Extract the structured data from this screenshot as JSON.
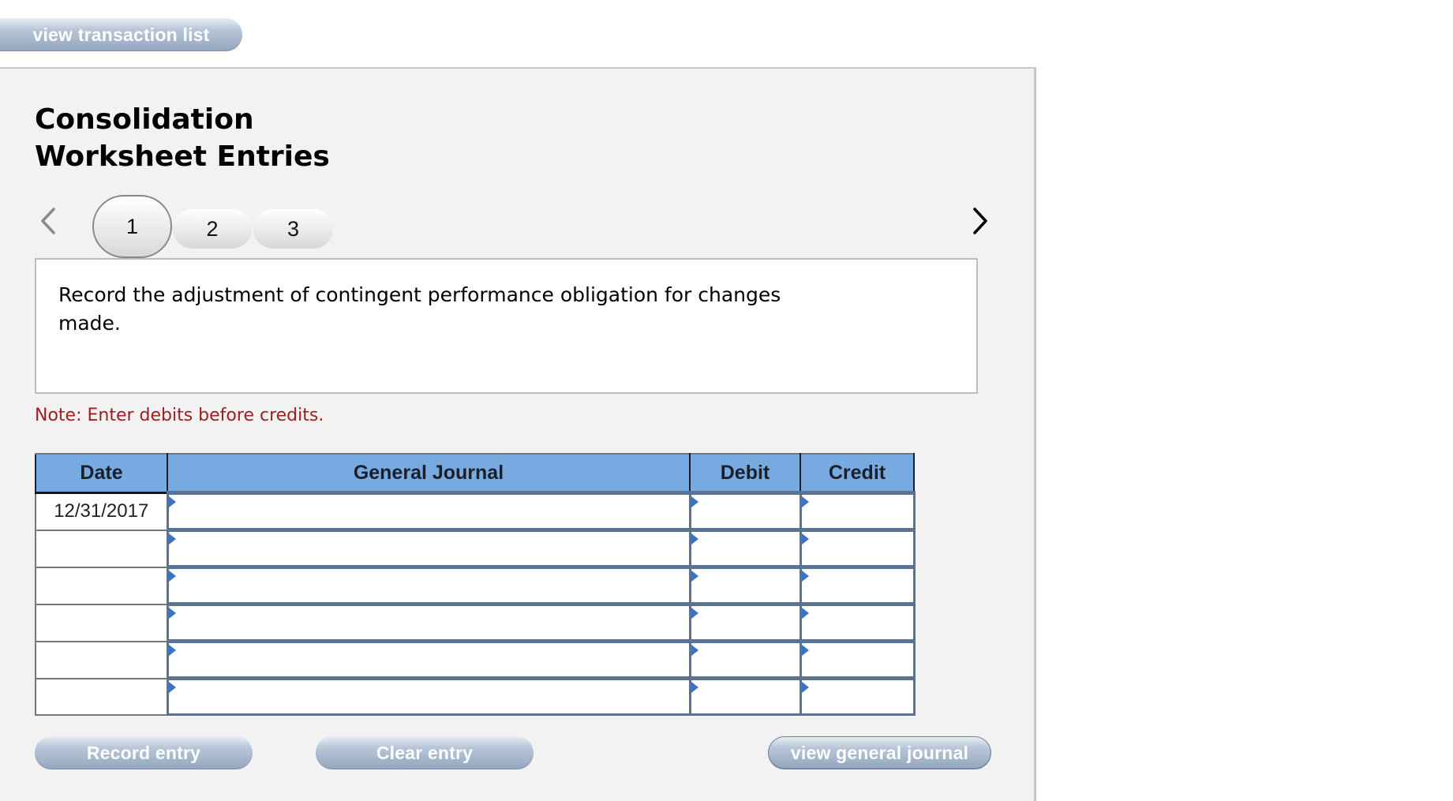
{
  "top_button": {
    "label": "view transaction list"
  },
  "panel": {
    "title_line1": "Consolidation",
    "title_line2": "Worksheet Entries",
    "nav": {
      "prev_icon": "chevron-left-icon",
      "next_icon": "chevron-right-icon"
    },
    "tabs": [
      {
        "label": "1",
        "active": true
      },
      {
        "label": "2",
        "active": false
      },
      {
        "label": "3",
        "active": false
      }
    ],
    "prompt": "Record the adjustment of contingent performance obligation for changes made.",
    "note": "Note: Enter debits before credits.",
    "colors": {
      "header_bg": "#78aae2",
      "note_text": "#a01e1e",
      "input_border": "#5a7394"
    }
  },
  "journal": {
    "columns": [
      "Date",
      "General Journal",
      "Debit",
      "Credit"
    ],
    "rows": [
      {
        "date": "12/31/2017",
        "account": "",
        "debit": "",
        "credit": ""
      },
      {
        "date": "",
        "account": "",
        "debit": "",
        "credit": ""
      },
      {
        "date": "",
        "account": "",
        "debit": "",
        "credit": ""
      },
      {
        "date": "",
        "account": "",
        "debit": "",
        "credit": ""
      },
      {
        "date": "",
        "account": "",
        "debit": "",
        "credit": ""
      },
      {
        "date": "",
        "account": "",
        "debit": "",
        "credit": ""
      }
    ]
  },
  "buttons": {
    "record": "Record entry",
    "clear": "Clear entry",
    "view_general_journal": "view general journal"
  }
}
